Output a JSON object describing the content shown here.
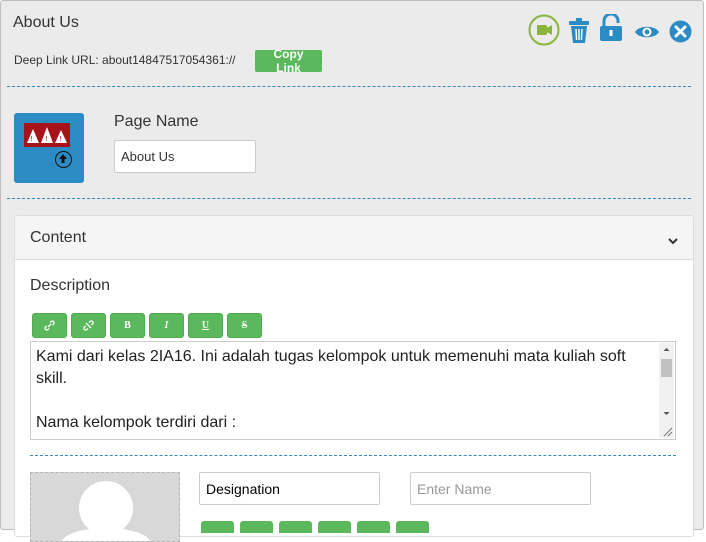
{
  "header": {
    "title": "About Us",
    "deep_link_label": "Deep Link URL: about14847517054361://",
    "copy_link_label": "Copy Link"
  },
  "toolbar": {
    "icons": [
      "video-icon",
      "trash-icon",
      "unlock-icon",
      "eye-icon",
      "close-circle-icon"
    ]
  },
  "page_name": {
    "label": "Page Name",
    "value": "About Us"
  },
  "content": {
    "title": "Content",
    "description_label": "Description",
    "format_buttons": [
      "link-icon",
      "unlink-icon",
      "bold-icon",
      "italic-icon",
      "underline-icon",
      "strikethrough-icon"
    ],
    "format_glyphs": [
      "🔗",
      "⦸",
      "B",
      "I",
      "U",
      "S"
    ],
    "description_text": "Kami dari kelas 2IA16. Ini adalah tugas kelompok untuk memenuhi mata kuliah soft skill.\n\nNama kelompok terdiri dari :"
  },
  "member": {
    "designation_value": "Designation",
    "name_placeholder": "Enter Name"
  },
  "colors": {
    "accent_green": "#5cb85c",
    "icon_blue": "#2d8bc4",
    "video_ring": "#8cb33a"
  }
}
